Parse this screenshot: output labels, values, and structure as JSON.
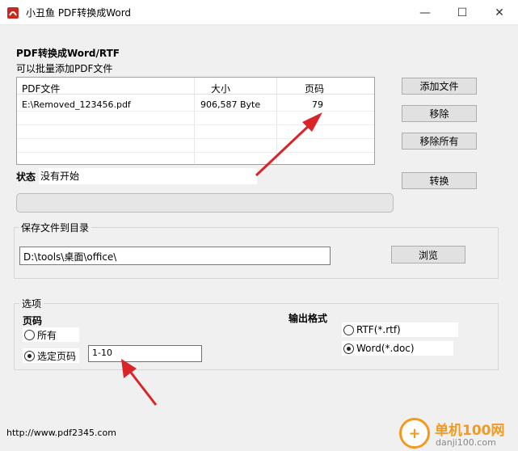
{
  "window": {
    "title": "小丑鱼 PDF转换成Word",
    "minimize_glyph": "—",
    "maximize_glyph": "☐",
    "close_glyph": "✕"
  },
  "section": {
    "title": "PDF转换成Word/RTF",
    "subtitle": "可以批量添加PDF文件"
  },
  "file_table": {
    "headers": [
      "PDF文件",
      "大小",
      "页码"
    ],
    "rows": [
      {
        "file": "E:\\Removed_123456.pdf",
        "size": "906,587 Byte",
        "pages": "79"
      }
    ]
  },
  "buttons": {
    "add_file": "添加文件",
    "remove": "移除",
    "remove_all": "移除所有",
    "convert": "转换",
    "browse": "浏览"
  },
  "status": {
    "label": "状态",
    "value": "没有开始"
  },
  "save": {
    "group_title": "保存文件到目录",
    "path": "D:\\tools\\桌面\\office\\"
  },
  "options": {
    "group_title": "选项",
    "pages_label": "页码",
    "all_label": "所有",
    "selected_label": "选定页码",
    "page_range": "1-10",
    "output_format_label": "输出格式",
    "rtf_label": "RTF(*.rtf)",
    "word_label": "Word(*.doc)"
  },
  "footer": {
    "url": "http://www.pdf2345.com"
  },
  "watermark": {
    "top": "单机100网",
    "bottom": "danji100.com"
  },
  "colors": {
    "arrow": "#d9252a",
    "watermark": "#f39a1e"
  }
}
